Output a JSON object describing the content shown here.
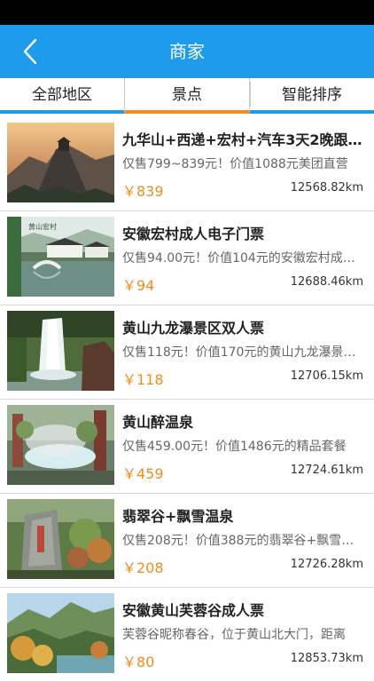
{
  "header": {
    "title": "商家",
    "back_icon": "chevron-left-icon"
  },
  "tabs": [
    {
      "label": "全部地区",
      "active": false
    },
    {
      "label": "景点",
      "active": true
    },
    {
      "label": "智能排序",
      "active": false
    }
  ],
  "colors": {
    "primary": "#1e9bea",
    "accent": "#f08c1e"
  },
  "items": [
    {
      "title": "九华山+西递+宏村+汽车3天2晚跟团游",
      "desc": "仅售799~839元！价值1088元美团直营",
      "price": "￥839",
      "distance": "12568.82km"
    },
    {
      "title": "安徽宏村成人电子门票",
      "desc": "仅售94.00元！价值104元的安徽宏村成人电子门票",
      "price": "￥94",
      "distance": "12688.46km",
      "thumb_caption": "黄山宏村"
    },
    {
      "title": "黄山九龙瀑景区双人票",
      "desc": "仅售118元！价值170元的黄山九龙瀑景区双人票",
      "price": "￥118",
      "distance": "12706.15km"
    },
    {
      "title": "黄山醉温泉",
      "desc": "仅售459.00元！价值1486元的精品套餐",
      "price": "￥459",
      "distance": "12724.61km"
    },
    {
      "title": "翡翠谷+飘雪温泉",
      "desc": "仅售208元！价值388元的翡翠谷+飘雪温泉门票",
      "price": "￥208",
      "distance": "12726.28km"
    },
    {
      "title": "安徽黄山芙蓉谷成人票",
      "desc": "芙蓉谷昵称春谷，位于黄山北大门，距离",
      "price": "￥80",
      "distance": "12853.73km"
    }
  ]
}
